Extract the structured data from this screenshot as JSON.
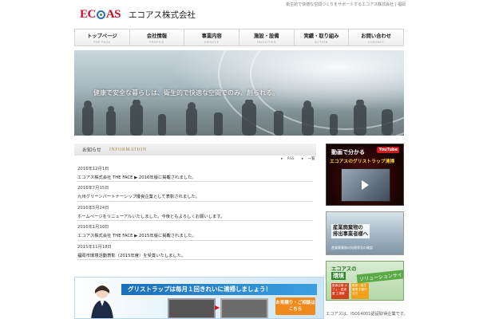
{
  "site": {
    "tagline": "衛生的で快適な空間づくりをサポートするエコアス株式会社 | 福岡",
    "logo_text_left": "EC",
    "logo_text_right": "AS",
    "company_name": "エコアス株式会社"
  },
  "nav": [
    {
      "jp": "トップページ",
      "en": "TOP PAGE"
    },
    {
      "jp": "会社情報",
      "en": "PROFILE"
    },
    {
      "jp": "事業内容",
      "en": "SERVICE"
    },
    {
      "jp": "施設・設備",
      "en": "FACILITIES"
    },
    {
      "jp": "実績・取り組み",
      "en": "ACTION"
    },
    {
      "jp": "お問い合わせ",
      "en": "CONTACT"
    }
  ],
  "hero": {
    "caption": "健康で安全な暮らしは、衛生的で快適な空間でのみ、創られる。"
  },
  "news": {
    "heading_jp": "お知らせ",
    "heading_en": "INFORMATION",
    "rss_label": "RSS",
    "list_label": "一覧",
    "items": [
      {
        "date": "2016年12月1日",
        "title": "エコアス株式会社 THE FACE ▶ 2016年版に掲載されました。"
      },
      {
        "date": "2016年7月15日",
        "title": "九州グリーンパートナーシップ優良企業として表彰されました。"
      },
      {
        "date": "2016年5月24日",
        "title": "ホームページをリニューアルいたしました。今後ともよろしくお願いします。"
      },
      {
        "date": "2016年1月10日",
        "title": "エコアス株式会社 THE FACE ▶ 2015年版に掲載されました。"
      },
      {
        "date": "2015年11月18日",
        "title": "福岡市環境活動表彰（2015年度）を受賞いたしました。"
      }
    ]
  },
  "banner_bottom": {
    "title": "グリストラップは毎月１回きれいに清掃しましょう！",
    "cta": "お見積り・ご相談はこちら"
  },
  "side_banners": {
    "video": {
      "line1": "動画で分かる",
      "line2": "エコアスのグリストラップ清掃",
      "badge": "YouTube"
    },
    "waste": {
      "line1": "産業廃棄物の",
      "line2": "排出事業者様へ",
      "sub": "産業廃棄物の処理状況の確認"
    },
    "env": {
      "line1": "エコアスの",
      "line2": "環境",
      "line3": "ソリューションサイト",
      "badge1": "飲食店様 カフェ・居酒屋 工場様",
      "badge2": "厨房・衛生管理 お困りの方"
    },
    "footer_text": "エコアスは、ISO14001認証取得企業です。"
  }
}
